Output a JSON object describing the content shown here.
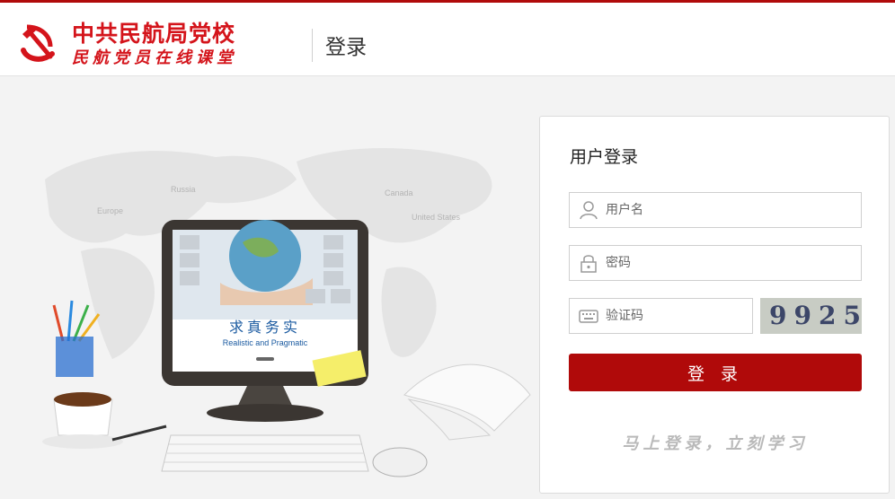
{
  "header": {
    "org_name": "中共民航局党校",
    "org_subtitle": "民航党员在线课堂",
    "page_title": "登录"
  },
  "hero": {
    "slogan_cn": "求真务实",
    "slogan_en": "Realistic and Pragmatic",
    "map_labels": [
      "Russia",
      "Europe",
      "Canada",
      "United States"
    ]
  },
  "login": {
    "title": "用户登录",
    "username_placeholder": "用户名",
    "password_placeholder": "密码",
    "captcha_placeholder": "验证码",
    "captcha_code": "9925",
    "submit_label": "登 录",
    "footer_slogan": "马上登录，立刻学习"
  },
  "icons": {
    "username": "user-icon",
    "password": "lock-icon",
    "captcha": "keyboard-icon"
  },
  "colors": {
    "brand_red": "#b00a0a",
    "logo_red": "#d4141b"
  }
}
